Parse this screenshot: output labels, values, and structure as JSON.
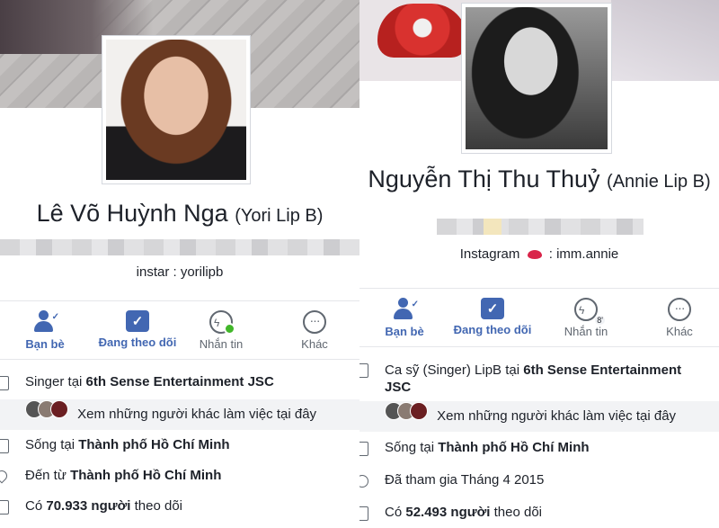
{
  "left": {
    "name": "Lê Võ Huỳnh Nga",
    "nickname": "(Yori Lip B)",
    "bio": "instar : yorilipb",
    "actions": [
      {
        "label": "Bạn bè",
        "icon": "friends-icon"
      },
      {
        "label": "Đang theo dõi",
        "icon": "following-icon"
      },
      {
        "label": "Nhắn tin",
        "icon": "messenger-icon"
      },
      {
        "label": "Khác",
        "icon": "more-icon"
      }
    ],
    "work": {
      "prefix": "Singer tại",
      "place": "6th Sense Entertainment JSC"
    },
    "coworkers": "Xem những người khác làm việc tại đây",
    "lives": {
      "prefix": "Sống tại",
      "place": "Thành phố Hồ Chí Minh"
    },
    "from": {
      "prefix": "Đến từ",
      "place": "Thành phố Hồ Chí Minh"
    },
    "followers": {
      "prefix": "Có",
      "count": "70.933 người",
      "suffix": "theo dõi"
    }
  },
  "right": {
    "name": "Nguyễn Thị Thu Thuỷ",
    "nickname": "(Annie Lip B)",
    "bio_prefix": "Instagram",
    "bio_suffix": ": imm.annie",
    "actions": [
      {
        "label": "Bạn bè",
        "icon": "friends-icon"
      },
      {
        "label": "Đang theo dõi",
        "icon": "following-icon"
      },
      {
        "label": "Nhắn tin",
        "icon": "messenger-icon",
        "badge": "8'"
      },
      {
        "label": "Khác",
        "icon": "more-icon"
      }
    ],
    "work": {
      "prefix": "Ca sỹ (Singer) LipB tại",
      "place": "6th Sense Entertainment JSC"
    },
    "coworkers": "Xem những người khác làm việc tại đây",
    "lives": {
      "prefix": "Sống tại",
      "place": "Thành phố Hồ Chí Minh"
    },
    "joined": "Đã tham gia Tháng 4 2015",
    "followers": {
      "prefix": "Có",
      "count": "52.493 người",
      "suffix": "theo dõi"
    }
  },
  "colors": {
    "accent": "#4267b2",
    "online": "#42b72a"
  }
}
